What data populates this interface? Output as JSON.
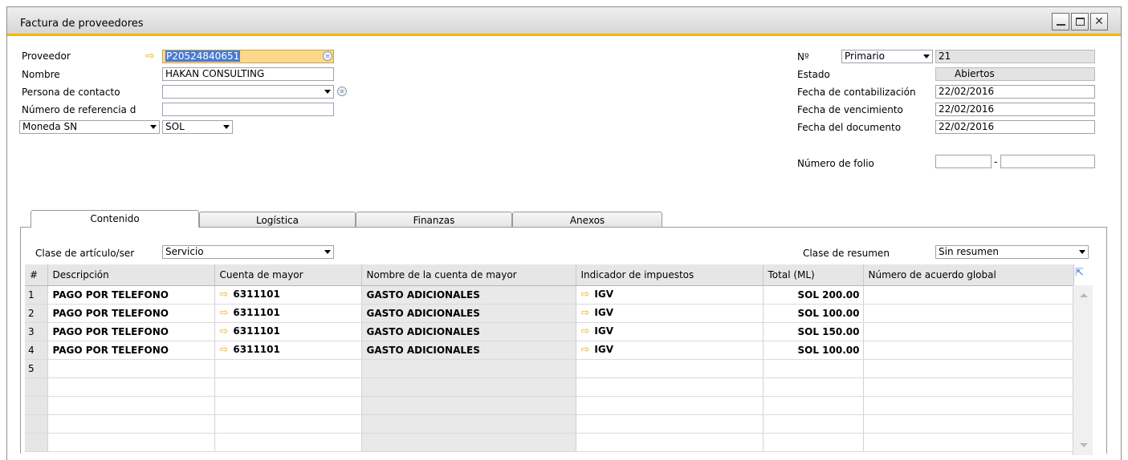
{
  "window": {
    "title": "Factura de proveedores"
  },
  "header": {
    "proveedor": {
      "label": "Proveedor",
      "value": "P20524840651"
    },
    "nombre": {
      "label": "Nombre",
      "value": "HAKAN CONSULTING"
    },
    "contacto": {
      "label": "Persona de contacto",
      "value": ""
    },
    "referencia": {
      "label": "Número de referencia d",
      "value": ""
    },
    "moneda": {
      "label": "Moneda SN",
      "value": "SOL"
    },
    "numero": {
      "label": "Nº",
      "series": "Primario",
      "value": "21"
    },
    "estado": {
      "label": "Estado",
      "value": "Abiertos"
    },
    "fecha_contabilizacion": {
      "label": "Fecha de contabilización",
      "value": "22/02/2016"
    },
    "fecha_vencimiento": {
      "label": "Fecha de vencimiento",
      "value": "22/02/2016"
    },
    "fecha_documento": {
      "label": "Fecha del documento",
      "value": "22/02/2016"
    },
    "folio": {
      "label": "Número de folio",
      "value1": "",
      "separator": "-",
      "value2": ""
    }
  },
  "tabs": [
    "Contenido",
    "Logística",
    "Finanzas",
    "Anexos"
  ],
  "content": {
    "clase_articulo": {
      "label": "Clase de artículo/ser",
      "value": "Servicio"
    },
    "clase_resumen": {
      "label": "Clase de resumen",
      "value": "Sin resumen"
    },
    "columns": [
      "#",
      "Descripción",
      "Cuenta de mayor",
      "Nombre de la cuenta de mayor",
      "Indicador de impuestos",
      "Total (ML)",
      "Número de acuerdo global"
    ],
    "rows": [
      {
        "n": "1",
        "desc": "PAGO POR TELEFONO",
        "cuenta": "6311101",
        "nombre": "GASTO ADICIONALES",
        "impuesto": "IGV",
        "total": "SOL 200.00",
        "acuerdo": ""
      },
      {
        "n": "2",
        "desc": "PAGO POR TELEFONO",
        "cuenta": "6311101",
        "nombre": "GASTO ADICIONALES",
        "impuesto": "IGV",
        "total": "SOL 100.00",
        "acuerdo": ""
      },
      {
        "n": "3",
        "desc": "PAGO POR TELEFONO",
        "cuenta": "6311101",
        "nombre": "GASTO ADICIONALES",
        "impuesto": "IGV",
        "total": "SOL 150.00",
        "acuerdo": ""
      },
      {
        "n": "4",
        "desc": "PAGO POR TELEFONO",
        "cuenta": "6311101",
        "nombre": "GASTO ADICIONALES",
        "impuesto": "IGV",
        "total": "SOL 100.00",
        "acuerdo": ""
      },
      {
        "n": "5",
        "desc": "",
        "cuenta": "",
        "nombre": "",
        "impuesto": "",
        "total": "",
        "acuerdo": ""
      },
      {
        "n": "",
        "desc": "",
        "cuenta": "",
        "nombre": "",
        "impuesto": "",
        "total": "",
        "acuerdo": ""
      },
      {
        "n": "",
        "desc": "",
        "cuenta": "",
        "nombre": "",
        "impuesto": "",
        "total": "",
        "acuerdo": ""
      },
      {
        "n": "",
        "desc": "",
        "cuenta": "",
        "nombre": "",
        "impuesto": "",
        "total": "",
        "acuerdo": ""
      },
      {
        "n": "",
        "desc": "",
        "cuenta": "",
        "nombre": "",
        "impuesto": "",
        "total": "",
        "acuerdo": ""
      }
    ]
  },
  "icons": {
    "link_arrow": "yellow-right-arrow-icon",
    "expand": "expand-icon",
    "choose_from_list": "list-icon"
  },
  "colors": {
    "title_accent": "#f4b611",
    "link_arrow": "#f2b21b",
    "selection": "#4a7bd1"
  }
}
